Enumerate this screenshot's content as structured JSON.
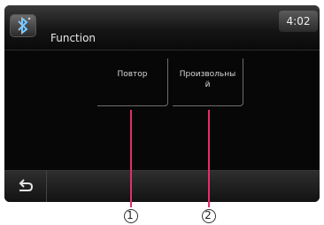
{
  "header": {
    "title": "Function",
    "clock": "4:02",
    "icon": "bluetooth-icon"
  },
  "menu": {
    "repeat_label": "Повтор",
    "shuffle_label": "Произвольны\nй"
  },
  "footer": {
    "back_icon": "back-arrow-icon"
  },
  "callouts": {
    "one": "1",
    "two": "2"
  },
  "colors": {
    "callout_line": "#e0306a",
    "screen_bg": "#080808"
  }
}
